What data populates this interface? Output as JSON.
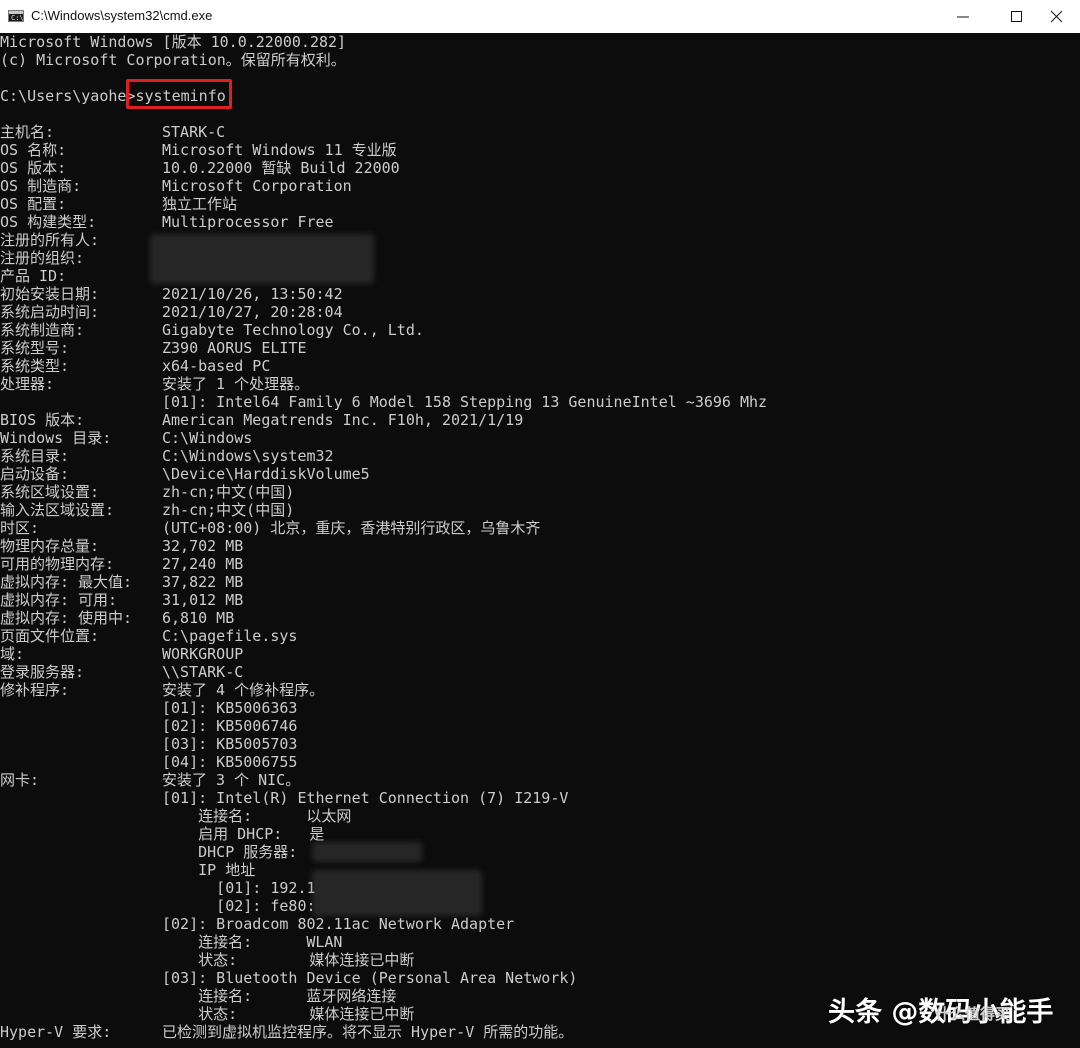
{
  "window": {
    "title": "C:\\Windows\\system32\\cmd.exe",
    "icon_text": "C:\\"
  },
  "console": {
    "header": [
      "Microsoft Windows [版本 10.0.22000.282]",
      "(c) Microsoft Corporation。保留所有权利。"
    ],
    "prompt": "C:\\Users\\yaohe>",
    "command": "systeminfo",
    "rows": [
      {
        "label": "主机名:",
        "value": "STARK-C"
      },
      {
        "label": "OS 名称:",
        "value": "Microsoft Windows 11 专业版"
      },
      {
        "label": "OS 版本:",
        "value": "10.0.22000 暂缺 Build 22000"
      },
      {
        "label": "OS 制造商:",
        "value": "Microsoft Corporation"
      },
      {
        "label": "OS 配置:",
        "value": "独立工作站"
      },
      {
        "label": "OS 构建类型:",
        "value": "Multiprocessor Free"
      },
      {
        "label": "注册的所有人:",
        "value": ""
      },
      {
        "label": "注册的组织:",
        "value": ""
      },
      {
        "label": "产品 ID:",
        "value": ""
      },
      {
        "label": "初始安装日期:",
        "value": "2021/10/26, 13:50:42"
      },
      {
        "label": "系统启动时间:",
        "value": "2021/10/27, 20:28:04"
      },
      {
        "label": "系统制造商:",
        "value": "Gigabyte Technology Co., Ltd."
      },
      {
        "label": "系统型号:",
        "value": "Z390 AORUS ELITE"
      },
      {
        "label": "系统类型:",
        "value": "x64-based PC"
      },
      {
        "label": "处理器:",
        "value": "安装了 1 个处理器。"
      },
      {
        "label": "",
        "value": "[01]: Intel64 Family 6 Model 158 Stepping 13 GenuineIntel ~3696 Mhz"
      },
      {
        "label": "BIOS 版本:",
        "value": "American Megatrends Inc. F10h, 2021/1/19"
      },
      {
        "label": "Windows 目录:",
        "value": "C:\\Windows"
      },
      {
        "label": "系统目录:",
        "value": "C:\\Windows\\system32"
      },
      {
        "label": "启动设备:",
        "value": "\\Device\\HarddiskVolume5"
      },
      {
        "label": "系统区域设置:",
        "value": "zh-cn;中文(中国)"
      },
      {
        "label": "输入法区域设置:",
        "value": "zh-cn;中文(中国)"
      },
      {
        "label": "时区:",
        "value": "(UTC+08:00) 北京，重庆，香港特别行政区，乌鲁木齐"
      },
      {
        "label": "物理内存总量:",
        "value": "32,702 MB"
      },
      {
        "label": "可用的物理内存:",
        "value": "27,240 MB"
      },
      {
        "label": "虚拟内存: 最大值:",
        "value": "37,822 MB"
      },
      {
        "label": "虚拟内存: 可用:",
        "value": "31,012 MB"
      },
      {
        "label": "虚拟内存: 使用中:",
        "value": "6,810 MB"
      },
      {
        "label": "页面文件位置:",
        "value": "C:\\pagefile.sys"
      },
      {
        "label": "域:",
        "value": "WORKGROUP"
      },
      {
        "label": "登录服务器:",
        "value": "\\\\STARK-C"
      },
      {
        "label": "修补程序:",
        "value": "安装了 4 个修补程序。"
      },
      {
        "label": "",
        "value": "[01]: KB5006363"
      },
      {
        "label": "",
        "value": "[02]: KB5006746"
      },
      {
        "label": "",
        "value": "[03]: KB5005703"
      },
      {
        "label": "",
        "value": "[04]: KB5006755"
      },
      {
        "label": "网卡:",
        "value": "安装了 3 个 NIC。"
      },
      {
        "label": "",
        "value": "[01]: Intel(R) Ethernet Connection (7) I219-V"
      },
      {
        "label": "",
        "value": "    连接名:      以太网"
      },
      {
        "label": "",
        "value": "    启用 DHCP:   是"
      },
      {
        "label": "",
        "value": "    DHCP 服务器:"
      },
      {
        "label": "",
        "value": "    IP 地址"
      },
      {
        "label": "",
        "value": "      [01]: 192.1"
      },
      {
        "label": "",
        "value": "      [02]: fe80:"
      },
      {
        "label": "",
        "value": "[02]: Broadcom 802.11ac Network Adapter"
      },
      {
        "label": "",
        "value": "    连接名:      WLAN"
      },
      {
        "label": "",
        "value": "    状态:        媒体连接已中断"
      },
      {
        "label": "",
        "value": "[03]: Bluetooth Device (Personal Area Network)"
      },
      {
        "label": "",
        "value": "    连接名:      蓝牙网络连接"
      },
      {
        "label": "",
        "value": "    状态:        媒体连接已中断"
      },
      {
        "label": "Hyper-V 要求:",
        "value": "已检测到虚拟机监控程序。将不显示 Hyper-V 所需的功能。"
      }
    ]
  },
  "watermark": {
    "text": "头条 @数码小能手",
    "logo": "什么值得买"
  },
  "colors": {
    "background": "#0c0c0c",
    "text": "#cccccc",
    "highlight": "#e02020"
  }
}
